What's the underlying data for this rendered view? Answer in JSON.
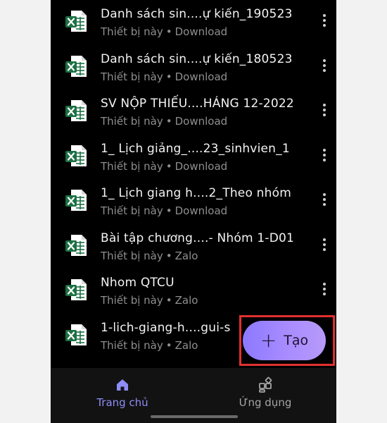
{
  "files": [
    {
      "name": "Danh sách sin....ự kiến_190523",
      "location": "Thiết bị này",
      "source": "Download"
    },
    {
      "name": "Danh sách sin....ự kiến_180523",
      "location": "Thiết bị này",
      "source": "Download"
    },
    {
      "name": "SV NỘP THIẾU....HÁNG 12-2022",
      "location": "Thiết bị này",
      "source": "Download"
    },
    {
      "name": "1_ Lịch giảng_....23_sinhvien_1",
      "location": "Thiết bị này",
      "source": "Download"
    },
    {
      "name": "1_ Lịch giang h....2_Theo nhóm",
      "location": "Thiết bị này",
      "source": "Download"
    },
    {
      "name": "Bài tập chương....- Nhóm 1-D01",
      "location": "Thiết bị này",
      "source": "Zalo"
    },
    {
      "name": "Nhom QTCU",
      "location": "Thiết bị này",
      "source": "Zalo"
    },
    {
      "name": "1-lich-giang-h....gui-s",
      "location": "Thiết bị này",
      "source": "Zalo"
    }
  ],
  "meta_separator": "•",
  "fab": {
    "label": "Tạo",
    "icon": "plus-icon"
  },
  "nav": [
    {
      "label": "Trang chủ",
      "icon": "home-icon",
      "active": true
    },
    {
      "label": "Ứng dụng",
      "icon": "apps-icon",
      "active": false
    }
  ],
  "colors": {
    "excel_green": "#1d7044",
    "accent": "#8e8cf6",
    "fab_gradient_start": "#8d79ff",
    "fab_gradient_end": "#b79af8",
    "highlight_border": "#e0312f"
  }
}
